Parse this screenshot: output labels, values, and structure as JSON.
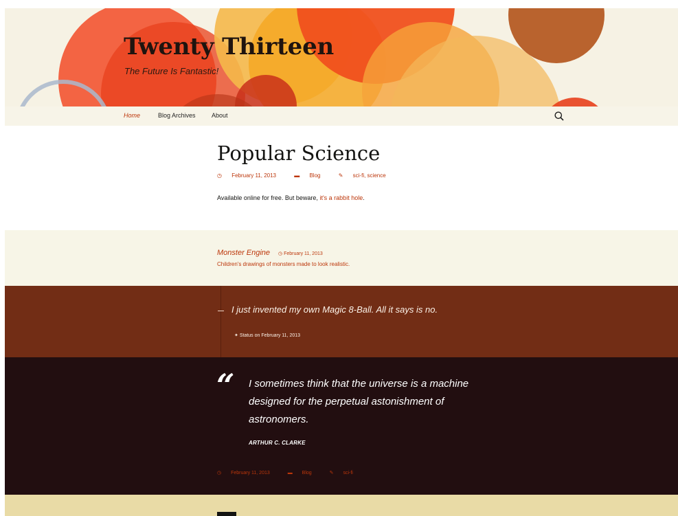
{
  "header": {
    "site_title": "Twenty Thirteen",
    "tagline": "The Future Is Fantastic!"
  },
  "nav": {
    "items": [
      {
        "label": "Home",
        "active": true
      },
      {
        "label": "Blog Archives",
        "active": false
      },
      {
        "label": "About",
        "active": false
      }
    ],
    "search_icon": "search-icon"
  },
  "post1": {
    "title": "Popular Science",
    "date": "February 11, 2013",
    "category": "Blog",
    "tags": "sci-fi, science",
    "content_text": "Available online for free. But beware,",
    "content_link": "it's a rabbit hole",
    "content_end": "."
  },
  "post2": {
    "title": "Monster Engine",
    "date": "February 11, 2013",
    "description": "Children's drawings of monsters made to look realistic."
  },
  "post3": {
    "text": "I just invented my own Magic 8-Ball. All it says is no.",
    "meta": "Status on February 11, 2013"
  },
  "post4": {
    "quote_mark": "“",
    "quote": "I sometimes think that the universe is a machine designed for the perpetual astonishment of astronomers.",
    "author": "ARTHUR C. CLARKE",
    "date": "February 11, 2013",
    "category": "Blog",
    "tags": "sci-fi"
  },
  "colors": {
    "accent": "#bc360a",
    "status_bg": "#722d15",
    "quote_bg": "#220e10",
    "link_bg": "#f7f5e7",
    "next_bg": "#e9dba6"
  }
}
